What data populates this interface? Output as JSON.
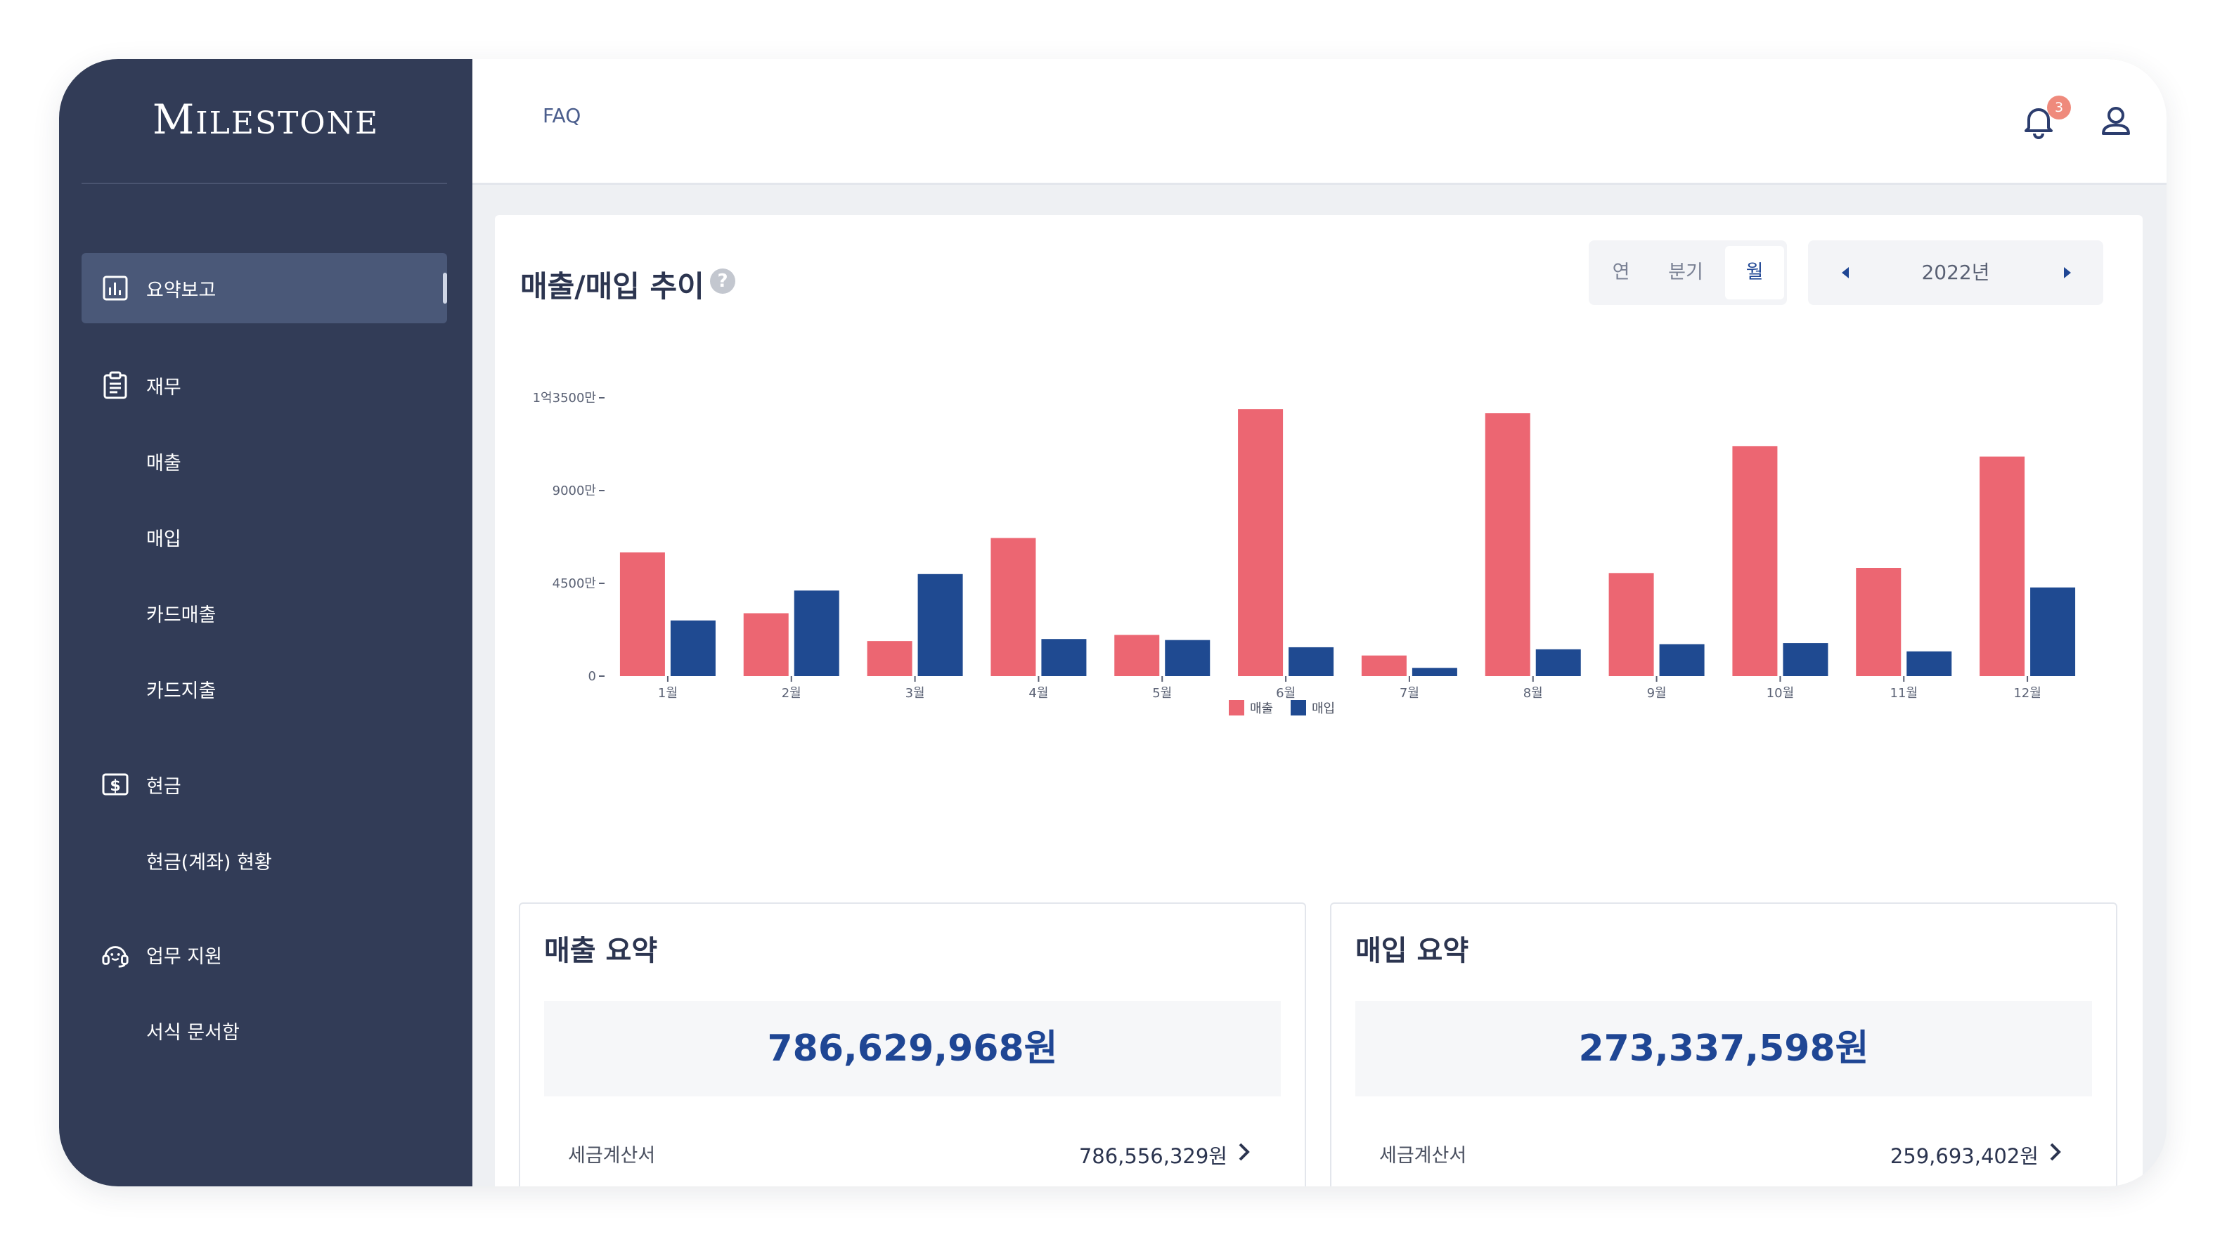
{
  "app": {
    "logo": "MILESTONE"
  },
  "sidebar": {
    "items": [
      {
        "label": "요약보고",
        "icon": "bar-chart-icon",
        "active": true
      },
      {
        "label": "재무",
        "icon": "clipboard-icon"
      },
      {
        "label": "매출"
      },
      {
        "label": "매입"
      },
      {
        "label": "카드매출"
      },
      {
        "label": "카드지출"
      },
      {
        "label": "현금",
        "icon": "dollar-icon"
      },
      {
        "label": "현금(계좌) 현황"
      },
      {
        "label": "업무 지원",
        "icon": "headset-icon"
      },
      {
        "label": "서식 문서함"
      }
    ]
  },
  "topbar": {
    "faq": "FAQ",
    "notification_count": "3"
  },
  "chart_card": {
    "title": "매출/매입 추이",
    "periods": [
      "연",
      "분기",
      "월"
    ],
    "active_period": "월",
    "year": "2022년"
  },
  "chart_data": {
    "type": "bar",
    "categories": [
      "1월",
      "2월",
      "3월",
      "4월",
      "5월",
      "6월",
      "7월",
      "8월",
      "9월",
      "10월",
      "11월",
      "12월"
    ],
    "series": [
      {
        "name": "매출",
        "color": "#ec6672",
        "values": [
          60000000,
          30500000,
          17000000,
          67000000,
          20000000,
          129500000,
          10000000,
          127500000,
          50000000,
          111500000,
          52500000,
          106500000
        ]
      },
      {
        "name": "매입",
        "color": "#1f4a91",
        "values": [
          27000000,
          41500000,
          49500000,
          18000000,
          17500000,
          14000000,
          4000000,
          13000000,
          15500000,
          16000000,
          12000000,
          43000000
        ]
      }
    ],
    "yticks": [
      0,
      45000000,
      90000000,
      135000000
    ],
    "ytick_labels": [
      "0",
      "4500만",
      "9000만",
      "1억3500만"
    ],
    "ylim": [
      0,
      135000000
    ],
    "legend": "bottom-center"
  },
  "summary": {
    "sales": {
      "title": "매출 요약",
      "total": "786,629,968원",
      "row_label": "세금계산서",
      "row_value": "786,556,329원"
    },
    "purchase": {
      "title": "매입 요약",
      "total": "273,337,598원",
      "row_label": "세금계산서",
      "row_value": "259,693,402원"
    }
  }
}
